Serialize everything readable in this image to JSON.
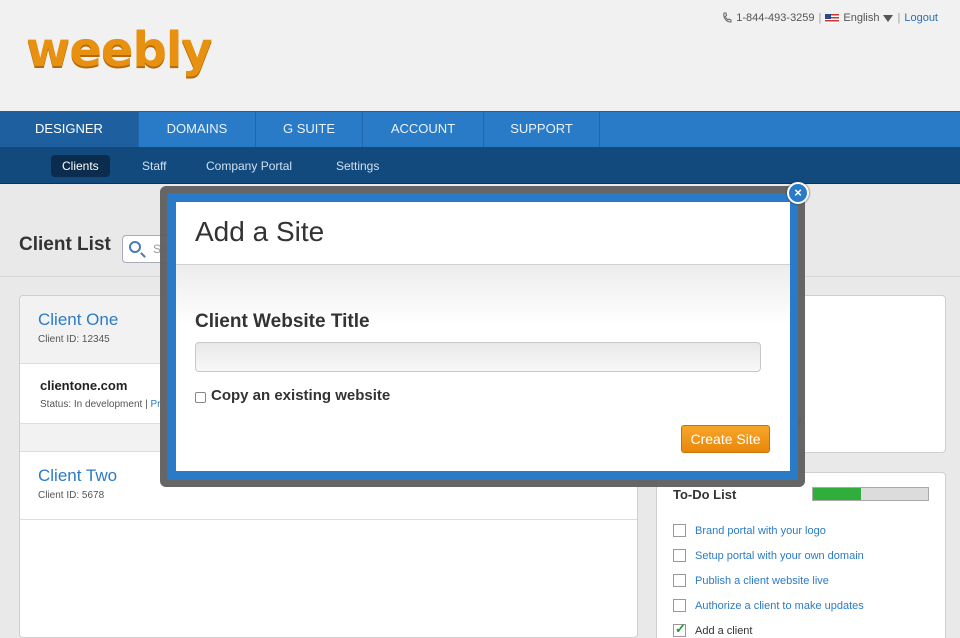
{
  "header": {
    "logo": "weebly",
    "phone": "1-844-493-3259",
    "language": "English",
    "logout": "Logout"
  },
  "main_nav": {
    "tabs": [
      "DESIGNER",
      "DOMAINS",
      "G SUITE",
      "ACCOUNT",
      "SUPPORT"
    ],
    "active": "DESIGNER"
  },
  "sub_nav": {
    "items": [
      "Clients",
      "Staff",
      "Company Portal",
      "Settings"
    ],
    "active": "Clients"
  },
  "page": {
    "title": "Client List",
    "search_placeholder_fragment": "Se"
  },
  "clients": [
    {
      "name": "Client One",
      "id_label": "Client ID: 12345",
      "site_domain": "clientone.com",
      "site_status": "Status: In development |",
      "site_status_link_fragment": "Pr"
    },
    {
      "name": "Client Two",
      "id_label": "Client ID: 5678"
    }
  ],
  "right_panel_fragment": "2",
  "todo": {
    "title": "To-Do List",
    "progress": 0.42,
    "items": [
      {
        "label": "Brand portal with your logo",
        "done": false
      },
      {
        "label": "Setup portal with your own domain",
        "done": false
      },
      {
        "label": "Publish a client website live",
        "done": false
      },
      {
        "label": "Authorize a client to make updates",
        "done": false
      },
      {
        "label": "Add a client",
        "done": true
      }
    ]
  },
  "modal": {
    "title": "Add a Site",
    "field_label": "Client Website Title",
    "field_value": "",
    "copy_label": "Copy an existing website",
    "copy_checked": false,
    "submit_label": "Create Site",
    "close_glyph": "×"
  },
  "colors": {
    "accent_blue": "#2a7bc7",
    "nav_dark": "#124a7e",
    "logo_orange": "#e8900f",
    "button_orange": "#f29a1e",
    "progress_green": "#2fae3b"
  }
}
